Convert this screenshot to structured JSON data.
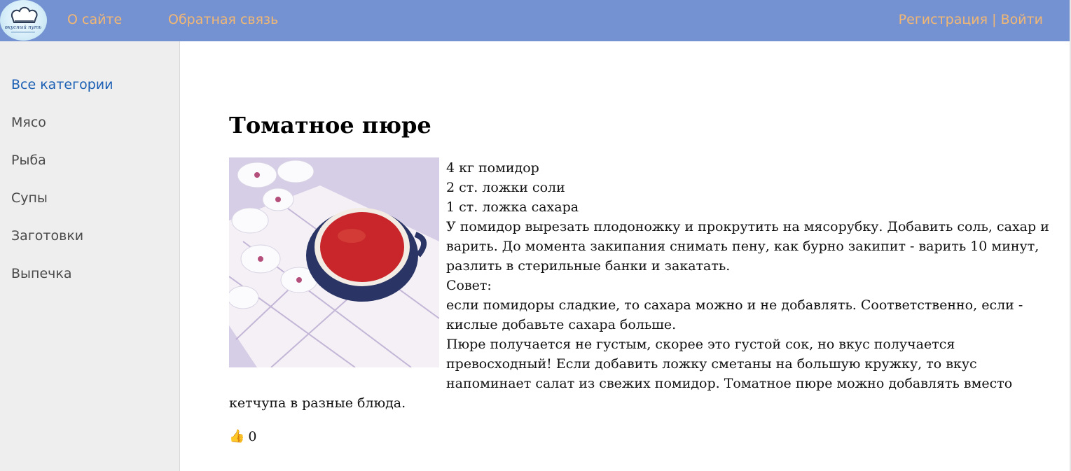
{
  "header": {
    "logo_text": "вкусный путь",
    "nav": {
      "about": "О сайте",
      "feedback": "Обратная связь"
    },
    "auth": {
      "register": "Регистрация",
      "separator": " | ",
      "login": "Войти"
    }
  },
  "sidebar": {
    "categories": [
      {
        "label": "Все категории",
        "active": true
      },
      {
        "label": "Мясо"
      },
      {
        "label": "Рыба"
      },
      {
        "label": "Супы"
      },
      {
        "label": "Заготовки"
      },
      {
        "label": "Выпечка"
      }
    ]
  },
  "recipe": {
    "title": "Томатное пюре",
    "lines": [
      "4 кг помидор",
      "2 ст. ложки соли",
      "1 ст. ложка сахара",
      "У помидор вырезать плодоножку и прокрутить на мясорубку. Добавить соль, сахар и",
      "варить. До момента закипания снимать пену, как бурно закипит - варить 10 минут,",
      "разлить в стерильные банки и закатать.",
      "Совет:",
      "если помидоры сладкие, то сахара можно и не добавлять. Соответственно, если -",
      "кислые добавьте сахара больше.",
      "Пюре получается не густым, скорее это густой сок, но вкус получается",
      "превосходный! Если добавить ложку сметаны на большую кружку, то вкус",
      "напоминает салат из свежих помидор. Томатное пюре можно добавлять вместо",
      "кетчупа в разные блюда."
    ],
    "likes": "0"
  },
  "icons": {
    "thumbs_up": "thumbs-up-icon"
  }
}
